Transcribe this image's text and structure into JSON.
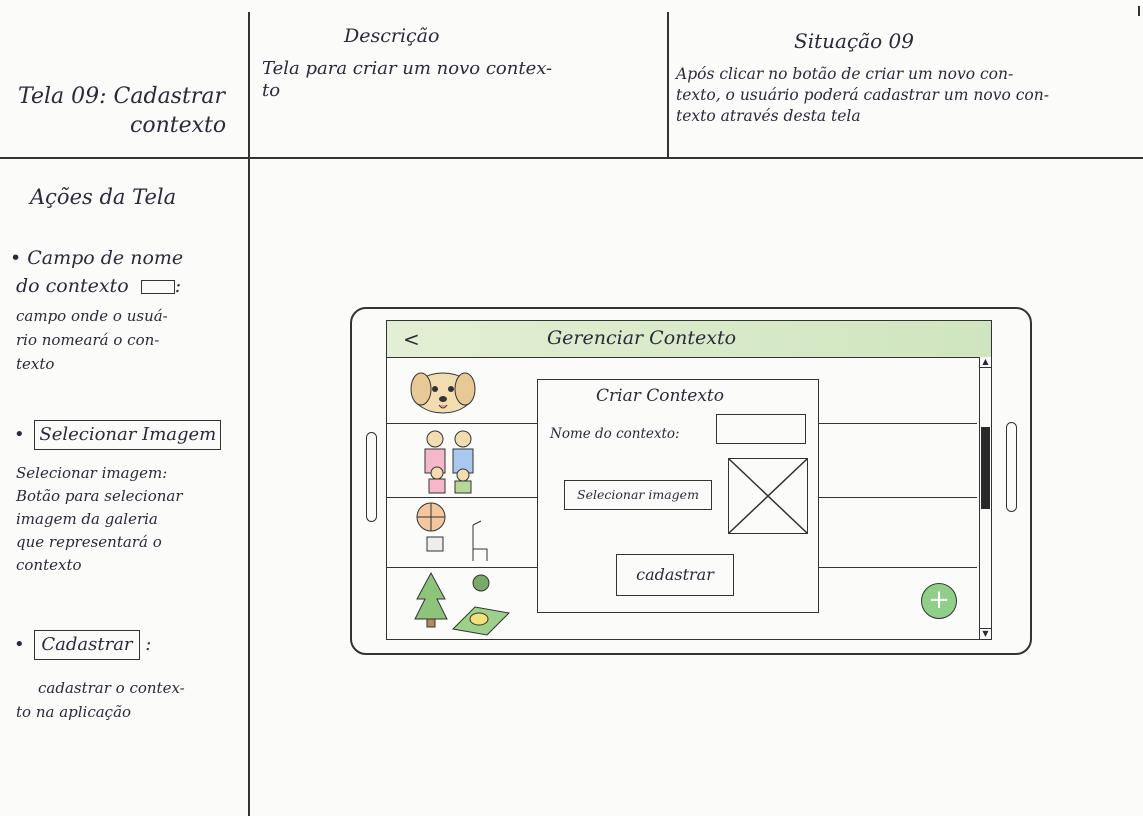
{
  "header": {
    "screen_title_line1": "Tela 09: Cadastrar",
    "screen_title_line2": "contexto",
    "description_heading": "Descrição",
    "description_line1": "Tela para criar um novo contex-",
    "description_line2": "to",
    "situation_heading": "Situação 09",
    "situation_line1": "Após clicar no botão de criar um novo con-",
    "situation_line2": "texto, o usuário poderá cadastrar um novo con-",
    "situation_line3": "texto através desta tela"
  },
  "sidebar": {
    "heading": "Ações da Tela",
    "item1_line1": "• Campo de nome",
    "item1_line2": "do contexto",
    "item1_desc1": "campo onde o usuá-",
    "item1_desc2": "rio nomeará o con-",
    "item1_desc3": "texto",
    "item2_label": "Selecionar Imagem",
    "item2_desc1": "Selecionar imagem:",
    "item2_desc2": "Botão para selecionar",
    "item2_desc3": "imagem da galeria",
    "item2_desc4": "que representará o",
    "item2_desc5": "contexto",
    "item3_label": "Cadastrar",
    "item3_desc1": "cadastrar o contex-",
    "item3_desc2": "to na aplicação"
  },
  "app": {
    "back_symbol": "<",
    "title": "Gerenciar Contexto",
    "dialog_title": "Criar Contexto",
    "name_label": "Nome do contexto:",
    "select_image_label": "Selecionar imagem",
    "submit_label": "cadastrar",
    "add_symbol": "+",
    "accent_color": "#cfe5bf",
    "add_button_color": "#8fcf8a"
  }
}
